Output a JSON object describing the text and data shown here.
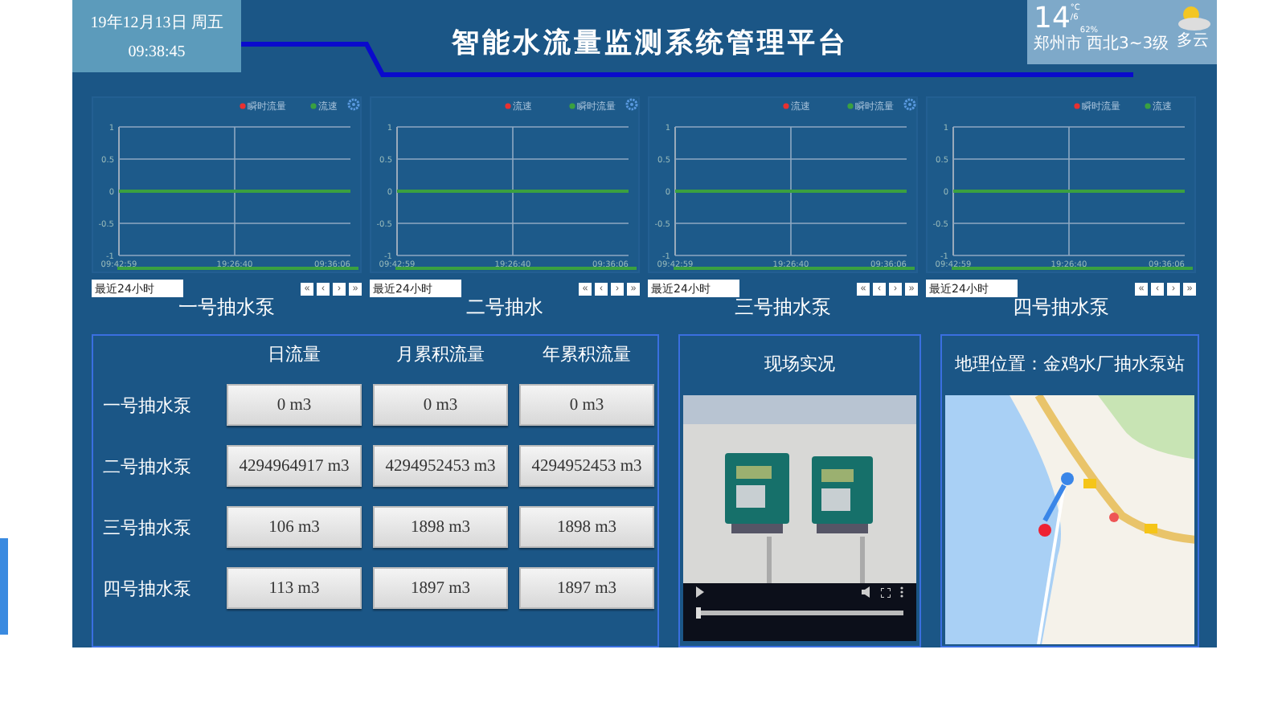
{
  "header": {
    "date": "19年12月13日 周五",
    "time": "09:38:45",
    "title": "智能水流量监测系统管理平台"
  },
  "weather": {
    "temperature": "14",
    "unit": "°C",
    "low": "/6",
    "humidity": "62%",
    "city": "郑州市",
    "wind": "西北3~3级",
    "condition": "多云"
  },
  "charts": [
    {
      "name": "一号抽水泵",
      "settings": true,
      "range": "最近24小时",
      "nav": [
        "«",
        "‹",
        "›",
        "»"
      ],
      "chart_data": {
        "type": "line",
        "grid": true,
        "categories": [
          "09:42:59",
          "19:26:40",
          "09:36:06"
        ],
        "ylim": [
          -1,
          1
        ],
        "yticks": [
          -1,
          -0.5,
          0,
          0.5,
          1
        ],
        "series": [
          {
            "name": "瞬时流量",
            "color": "#e83030",
            "values": [
              null,
              null,
              null
            ]
          },
          {
            "name": "流速",
            "color": "#3aa040",
            "values": [
              0,
              0,
              0
            ]
          }
        ]
      }
    },
    {
      "name": "二号抽水",
      "settings": true,
      "range": "最近24小时",
      "nav": [
        "«",
        "‹",
        "›",
        "»"
      ],
      "chart_data": {
        "type": "line",
        "grid": true,
        "categories": [
          "09:42:59",
          "19:26:40",
          "09:36:06"
        ],
        "ylim": [
          -1,
          1
        ],
        "yticks": [
          -1,
          -0.5,
          0,
          0.5,
          1
        ],
        "series": [
          {
            "name": "流速",
            "color": "#e83030",
            "values": [
              null,
              null,
              null
            ]
          },
          {
            "name": "瞬时流量",
            "color": "#3aa040",
            "values": [
              0,
              0,
              0
            ]
          }
        ]
      }
    },
    {
      "name": "三号抽水泵",
      "settings": true,
      "range": "最近24小时",
      "nav": [
        "«",
        "‹",
        "›",
        "»"
      ],
      "chart_data": {
        "type": "line",
        "grid": true,
        "categories": [
          "09:42:59",
          "19:26:40",
          "09:36:06"
        ],
        "ylim": [
          -1,
          1
        ],
        "yticks": [
          -1,
          -0.5,
          0,
          0.5,
          1
        ],
        "series": [
          {
            "name": "流速",
            "color": "#e83030",
            "values": [
              null,
              null,
              null
            ]
          },
          {
            "name": "瞬时流量",
            "color": "#3aa040",
            "values": [
              0,
              0,
              0
            ]
          }
        ]
      }
    },
    {
      "name": "四号抽水泵",
      "settings": false,
      "range": "最近24小时",
      "nav": [
        "«",
        "‹",
        "›",
        "»"
      ],
      "chart_data": {
        "type": "line",
        "grid": true,
        "categories": [
          "09:42:59",
          "19:26:40",
          "09:36:06"
        ],
        "ylim": [
          -1,
          1
        ],
        "yticks": [
          -1,
          -0.5,
          0,
          0.5,
          1
        ],
        "series": [
          {
            "name": "瞬时流量",
            "color": "#e83030",
            "values": [
              null,
              null,
              null
            ]
          },
          {
            "name": "流速",
            "color": "#3aa040",
            "values": [
              0,
              0,
              0
            ]
          }
        ]
      }
    }
  ],
  "table": {
    "columns": [
      "日流量",
      "月累积流量",
      "年累积流量"
    ],
    "rows": [
      {
        "name": "一号抽水泵",
        "cells": [
          "0 m3",
          "0 m3",
          "0 m3"
        ]
      },
      {
        "name": "二号抽水泵",
        "cells": [
          "4294964917 m3",
          "4294952453 m3",
          "4294952453 m3"
        ]
      },
      {
        "name": "三号抽水泵",
        "cells": [
          "106 m3",
          "1898 m3",
          "1898 m3"
        ]
      },
      {
        "name": "四号抽水泵",
        "cells": [
          "113 m3",
          "1897 m3",
          "1897 m3"
        ]
      }
    ]
  },
  "video": {
    "title": "现场实况",
    "kind": "picture",
    "progress": {
      "level": 0
    }
  },
  "map": {
    "title": "地理位置：金鸡水厂抽水泵站",
    "kind": "picture"
  }
}
